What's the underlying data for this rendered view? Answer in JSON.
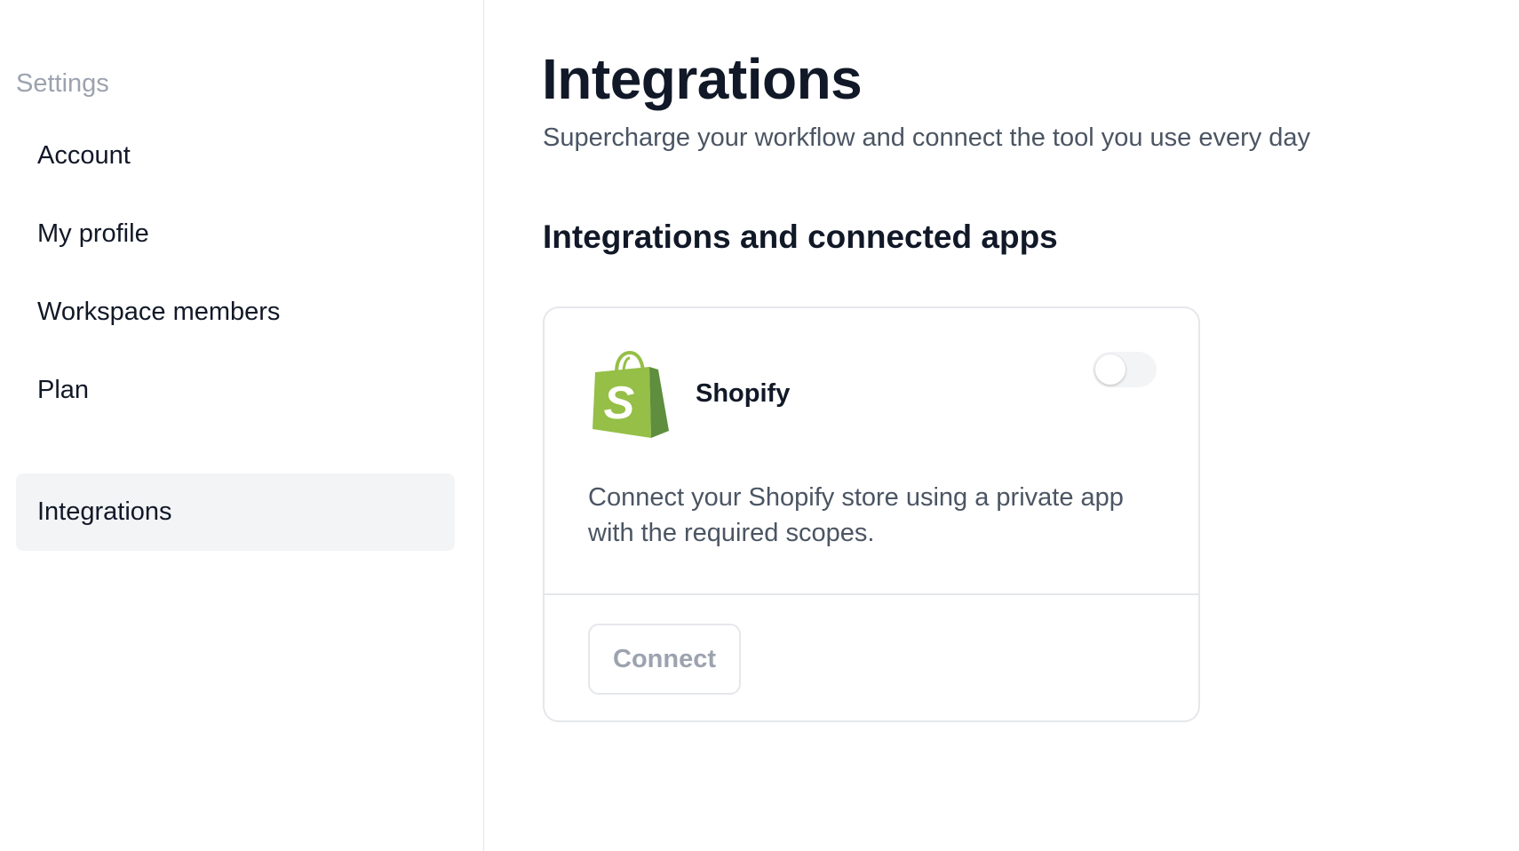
{
  "sidebar": {
    "heading": "Settings",
    "items": [
      {
        "label": "Account",
        "active": false
      },
      {
        "label": "My profile",
        "active": false
      },
      {
        "label": "Workspace members",
        "active": false
      },
      {
        "label": "Plan",
        "active": false
      },
      {
        "label": "Integrations",
        "active": true
      }
    ]
  },
  "main": {
    "title": "Integrations",
    "subtitle": "Supercharge your workflow and connect the tool you use every day",
    "section_title": "Integrations and connected apps",
    "card": {
      "name": "Shopify",
      "logo_icon": "shopify-logo-icon",
      "enabled": false,
      "description": "Connect your Shopify store using a private app with the required scopes.",
      "button_label": "Connect"
    }
  },
  "colors": {
    "text_primary": "#111827",
    "text_secondary": "#4b5563",
    "text_muted": "#9ca3af",
    "active_bg": "#f3f4f6",
    "border": "#e5e7eb",
    "shopify_green": "#95bf47",
    "shopify_dark_green": "#5e8e3e"
  }
}
